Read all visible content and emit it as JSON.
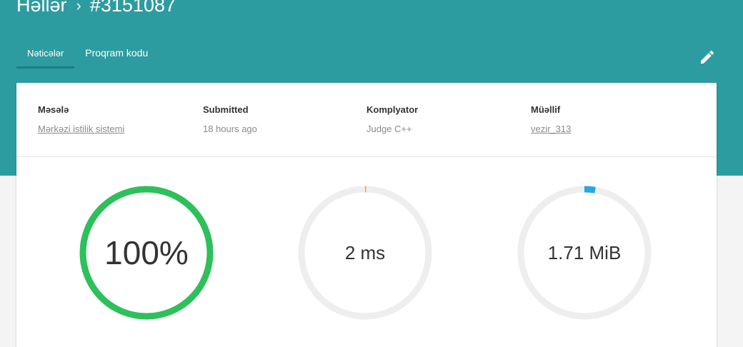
{
  "header": {
    "breadcrumb_root": "Həllər",
    "breadcrumb_sep": "›",
    "submission_id": "#3151087"
  },
  "tabs": [
    {
      "label": "Nəticələr",
      "active": true
    },
    {
      "label": "Proqram kodu",
      "active": false
    }
  ],
  "edit_icon": "pencil-icon",
  "details": {
    "problem": {
      "label": "Məsələ",
      "value": "Mərkəzi istilik sistemi"
    },
    "submitted": {
      "label": "Submitted",
      "value": "18 hours ago"
    },
    "compiler": {
      "label": "Komplyator",
      "value": "Judge C++"
    },
    "author": {
      "label": "Müəllif",
      "value": "vezir_313"
    }
  },
  "results": {
    "score": {
      "text": "100%",
      "fraction": 1.0,
      "color": "#2ec05a"
    },
    "time": {
      "text": "2 ms",
      "fraction": 0.002,
      "color": "#f0a81c"
    },
    "memory": {
      "text": "1.71 MiB",
      "fraction": 0.027,
      "color": "#25a8e0"
    }
  },
  "colors": {
    "header": "#2c9ca1",
    "track": "#eeeeee"
  }
}
